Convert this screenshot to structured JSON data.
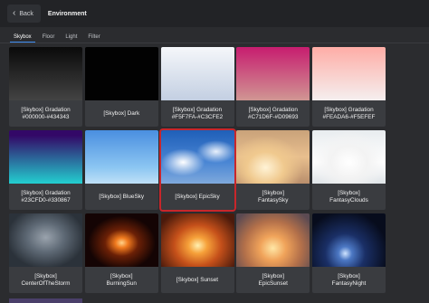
{
  "header": {
    "back_label": "Back",
    "title": "Environment"
  },
  "tabs": [
    {
      "label": "Skybox",
      "active": true
    },
    {
      "label": "Floor",
      "active": false
    },
    {
      "label": "Light",
      "active": false
    },
    {
      "label": "Filter",
      "active": false
    }
  ],
  "items": [
    {
      "label": "[Skybox] Gradation\n#000000-#434343",
      "selected": false
    },
    {
      "label": "[Skybox] Dark",
      "selected": false
    },
    {
      "label": "[Skybox] Gradation\n#F5F7FA-#C3CFE2",
      "selected": false
    },
    {
      "label": "[Skybox] Gradation\n#C71D6F-#D09693",
      "selected": false
    },
    {
      "label": "[Skybox] Gradation\n#FEADA6-#F5EFEF",
      "selected": false
    },
    {
      "label": "[Skybox] Gradation\n#23CFD0-#330867",
      "selected": false
    },
    {
      "label": "[Skybox] BlueSky",
      "selected": false
    },
    {
      "label": "[Skybox] EpicSky",
      "selected": true
    },
    {
      "label": "[Skybox]\nFantasySky",
      "selected": false
    },
    {
      "label": "[Skybox]\nFantasyClouds",
      "selected": false
    },
    {
      "label": "[Skybox]\nCenterOfTheStorm",
      "selected": false
    },
    {
      "label": "[Skybox]\nBurningSun",
      "selected": false
    },
    {
      "label": "[Skybox] Sunset",
      "selected": false
    },
    {
      "label": "[Skybox]\nEpicSunset",
      "selected": false
    },
    {
      "label": "[Skybox]\nFantasyNight",
      "selected": false
    }
  ],
  "accent_color": "#3d8cf0",
  "selection_color": "#c8262b"
}
